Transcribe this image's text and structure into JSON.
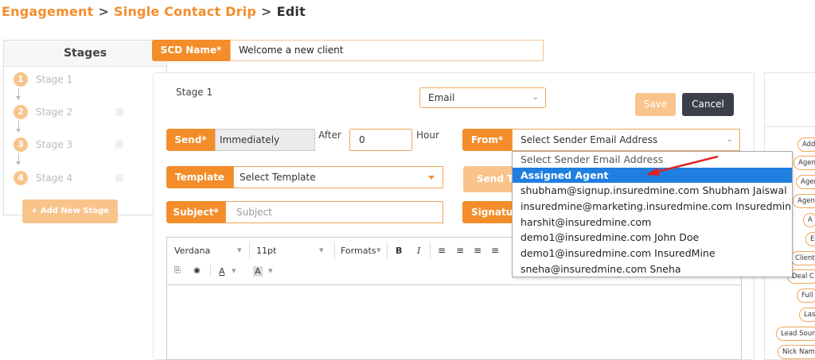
{
  "breadcrumb": {
    "items": [
      "Engagement",
      "Single Contact Drip"
    ],
    "current": "Edit",
    "separator": ">"
  },
  "stages_panel": {
    "title": "Stages",
    "stages": [
      {
        "number": "1",
        "label": "Stage 1"
      },
      {
        "number": "2",
        "label": "Stage 2"
      },
      {
        "number": "3",
        "label": "Stage 3"
      },
      {
        "number": "4",
        "label": "Stage 4"
      }
    ],
    "add_button": "+ Add New Stage"
  },
  "scd_name": {
    "label": "SCD Name*",
    "value": "Welcome a new client"
  },
  "stage_form": {
    "title": "Stage 1",
    "channel": "Email",
    "save_label": "Save",
    "cancel_label": "Cancel",
    "send_label": "Send*",
    "send_value": "Immediately",
    "after_label": "After",
    "after_value": "0",
    "hour_label": "Hour",
    "from_label": "From*",
    "from_value": "Select Sender Email Address",
    "template_label": "Template",
    "template_value": "Select Template",
    "send_test_label": "Send Test",
    "subject_label": "Subject*",
    "subject_placeholder": "Subject",
    "signature_label": "Signature"
  },
  "editor": {
    "font": "Verdana",
    "size": "11pt",
    "formats": "Formats",
    "bold": "B",
    "italic": "I",
    "font_color": "A",
    "bg_color": "A"
  },
  "from_dropdown": {
    "options": [
      "Select Sender Email Address",
      "Assigned Agent",
      "shubham@signup.insuredmine.com Shubham Jaiswal",
      "insuredmine@marketing.insuredmine.com Insuredmine",
      "harshit@insuredmine.com",
      "demo1@insuredmine.com John Doe",
      "demo1@insuredmine.com InsuredMine",
      "sneha@insuredmine.com Sneha"
    ],
    "highlighted_index": 1
  },
  "merge_fields": [
    "Add",
    "Agen",
    "Agen",
    "Agen",
    "A",
    "E",
    "Client",
    "Deal C",
    "Full",
    "Las",
    "Lead Sour",
    "Nick Nam"
  ],
  "colors": {
    "accent": "#f38d2a",
    "accent_faded": "#f8c48c",
    "selected": "#1e7fe0",
    "dark_button": "#3b3f4a",
    "arrow": "#e02020"
  }
}
